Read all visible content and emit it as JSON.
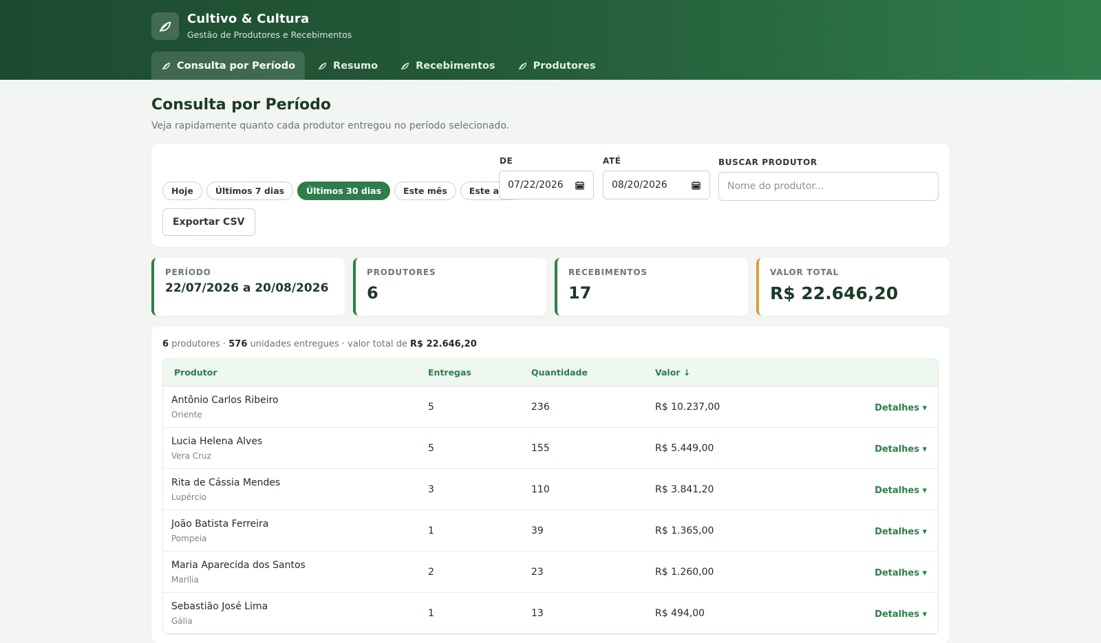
{
  "app": {
    "title": "Cultivo & Cultura",
    "subtitle": "Gestão de Produtores e Recebimentos"
  },
  "nav": [
    {
      "label": "Consulta por Período",
      "active": true
    },
    {
      "label": "Resumo",
      "active": false
    },
    {
      "label": "Recebimentos",
      "active": false
    },
    {
      "label": "Produtores",
      "active": false
    }
  ],
  "page": {
    "title": "Consulta por Período",
    "subtitle": "Veja rapidamente quanto cada produtor entregou no período selecionado."
  },
  "filters": {
    "quick": [
      {
        "label": "Hoje",
        "active": false
      },
      {
        "label": "Últimos 7 dias",
        "active": false
      },
      {
        "label": "Últimos 30 dias",
        "active": true
      },
      {
        "label": "Este mês",
        "active": false
      },
      {
        "label": "Este ano",
        "active": false
      }
    ],
    "export_label": "Exportar CSV",
    "from_label": "DE",
    "from_value": "07/22/2026",
    "to_label": "ATÉ",
    "to_value": "08/20/2026",
    "search_label": "BUSCAR PRODUTOR",
    "search_placeholder": "Nome do produtor..."
  },
  "stats": {
    "period": {
      "label": "PERÍODO",
      "value": "22/07/2026 a 20/08/2026"
    },
    "producers": {
      "label": "PRODUTORES",
      "value": "6"
    },
    "receipts": {
      "label": "RECEBIMENTOS",
      "value": "17"
    },
    "total": {
      "label": "VALOR TOTAL",
      "value": "R$ 22.646,20"
    }
  },
  "summary": {
    "producers_count": "6",
    "producers_text": "produtores ·",
    "units_count": "576",
    "units_text": "unidades entregues · valor total de",
    "total": "R$ 22.646,20"
  },
  "table": {
    "headers": {
      "producer": "Produtor",
      "deliveries": "Entregas",
      "quantity": "Quantidade",
      "value": "Valor ↓"
    },
    "details_label": "Detalhes ▾",
    "rows": [
      {
        "name": "Antônio Carlos Ribeiro",
        "city": "Oriente",
        "deliveries": "5",
        "quantity": "236",
        "value": "R$ 10.237,00"
      },
      {
        "name": "Lucia Helena Alves",
        "city": "Vera Cruz",
        "deliveries": "5",
        "quantity": "155",
        "value": "R$ 5.449,00"
      },
      {
        "name": "Rita de Cássia Mendes",
        "city": "Lupércio",
        "deliveries": "3",
        "quantity": "110",
        "value": "R$ 3.841,20"
      },
      {
        "name": "João Batista Ferreira",
        "city": "Pompeia",
        "deliveries": "1",
        "quantity": "39",
        "value": "R$ 1.365,00"
      },
      {
        "name": "Maria Aparecida dos Santos",
        "city": "Marília",
        "deliveries": "2",
        "quantity": "23",
        "value": "R$ 1.260,00"
      },
      {
        "name": "Sebastião José Lima",
        "city": "Gália",
        "deliveries": "1",
        "quantity": "13",
        "value": "R$ 494,00"
      }
    ]
  },
  "colors": {
    "brand": "#2e7d4a",
    "header_dark": "#1d4a30",
    "accent_gold": "#d4a03a"
  },
  "icons": {
    "brand": "leaf-icon",
    "nav": "leaf-icon",
    "date": "calendar-icon"
  }
}
